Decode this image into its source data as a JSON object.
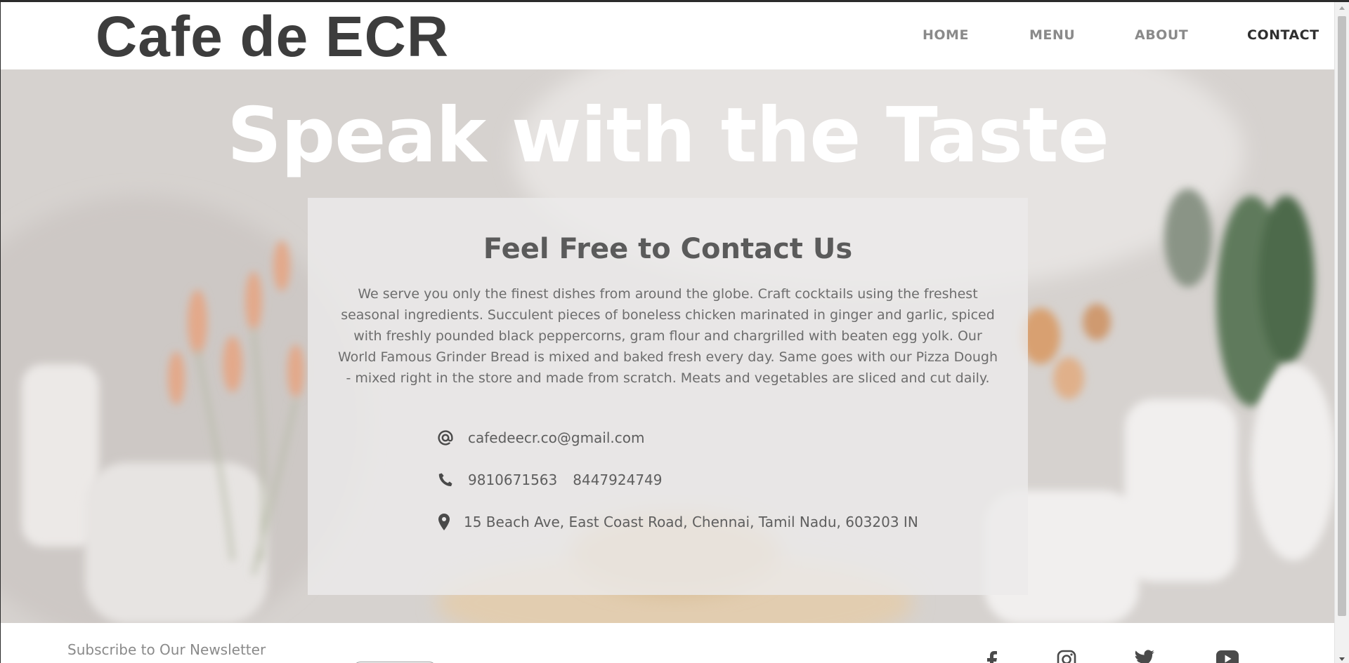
{
  "header": {
    "logo": "Cafe de ECR",
    "nav": [
      {
        "label": "HOME",
        "active": false
      },
      {
        "label": "MENU",
        "active": false
      },
      {
        "label": "ABOUT",
        "active": false
      },
      {
        "label": "CONTACT",
        "active": true
      }
    ]
  },
  "hero": {
    "title": "Speak with the Taste"
  },
  "contact_card": {
    "title": "Feel Free to Contact Us",
    "description": "We serve you only the finest dishes from around the globe. Craft cocktails using the freshest seasonal ingredients. Succulent pieces of boneless chicken marinated in ginger and garlic, spiced with freshly pounded black peppercorns, gram flour and chargrilled with beaten egg yolk. Our World Famous Grinder Bread is mixed and baked fresh every day. Same goes with our Pizza Dough - mixed right in the store and made from scratch. Meats and vegetables are sliced and cut daily.",
    "email": "cafedeecr.co@gmail.com",
    "phones": [
      "9810671563",
      "8447924749"
    ],
    "address": "15 Beach Ave, East Coast Road, Chennai, Tamil Nadu, 603203 IN",
    "icons": {
      "email": "at-icon",
      "phone": "phone-icon",
      "address": "map-marker-icon"
    }
  },
  "footer": {
    "newsletter_label": "Subscribe to Our Newsletter",
    "social": [
      {
        "name": "facebook-icon"
      },
      {
        "name": "instagram-icon"
      },
      {
        "name": "twitter-icon"
      },
      {
        "name": "youtube-icon"
      }
    ]
  },
  "colors": {
    "text_dark": "#3d3d3d",
    "nav_inactive": "#8a8a8a",
    "nav_active": "#2f2f2f",
    "hero_title": "#ffffff",
    "card_bg": "#ebeaea"
  }
}
